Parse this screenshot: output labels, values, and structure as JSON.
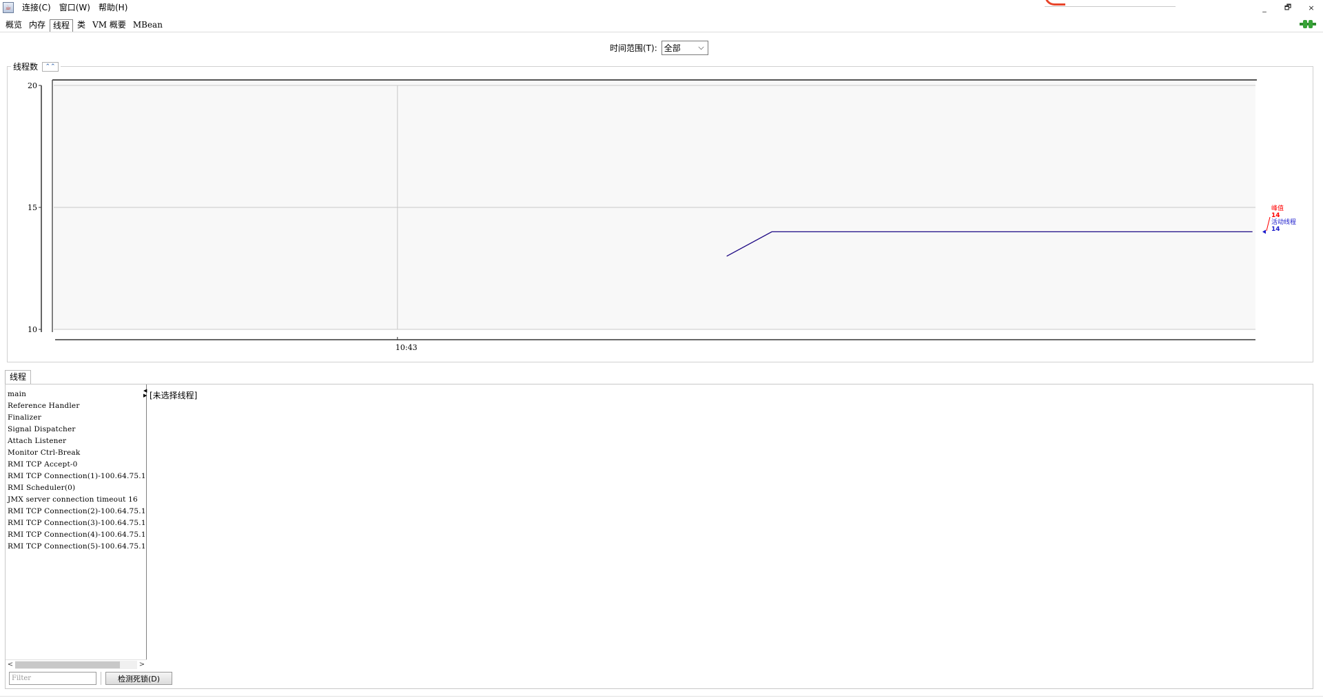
{
  "menu": {
    "items": [
      "连接(C)",
      "窗口(W)",
      "帮助(H)"
    ]
  },
  "window_controls": {
    "minimize": "_",
    "restore": "🗗",
    "close": "×"
  },
  "tabs": [
    {
      "label": "概览",
      "active": false
    },
    {
      "label": "内存",
      "active": false
    },
    {
      "label": "线程",
      "active": true
    },
    {
      "label": "类",
      "active": false
    },
    {
      "label": "VM 概要",
      "active": false
    },
    {
      "label": "MBean",
      "active": false
    }
  ],
  "time_range": {
    "label": "时间范围(T):",
    "selected": "全部"
  },
  "chart_panel": {
    "title": "线程数"
  },
  "chart_data": {
    "type": "line",
    "ylim": [
      10,
      20
    ],
    "yticks": [
      "20",
      "15",
      "10"
    ],
    "xticks": [
      "10:43"
    ],
    "series": [
      {
        "name": "峰值",
        "color": "#ff0000",
        "current_label": "14",
        "points": [
          [
            0.56,
            13
          ],
          [
            0.6,
            14
          ],
          [
            1.0,
            14
          ]
        ]
      },
      {
        "name": "活动线程",
        "color": "#1c1ccc",
        "current_label": "14",
        "points": [
          [
            0.56,
            13
          ],
          [
            0.6,
            14
          ],
          [
            1.0,
            14
          ]
        ]
      }
    ],
    "grid": true
  },
  "threads": {
    "tab_label": "线程",
    "list": [
      "main",
      "Reference Handler",
      "Finalizer",
      "Signal Dispatcher",
      "Attach Listener",
      "Monitor Ctrl-Break",
      "RMI TCP Accept-0",
      "RMI TCP Connection(1)-100.64.75.1",
      "RMI Scheduler(0)",
      "JMX server connection timeout 16",
      "RMI TCP Connection(2)-100.64.75.1",
      "RMI TCP Connection(3)-100.64.75.1",
      "RMI TCP Connection(4)-100.64.75.1",
      "RMI TCP Connection(5)-100.64.75.1"
    ],
    "detail_placeholder": "[未选择线程]",
    "filter_placeholder": "Filter",
    "deadlock_button": "检测死锁(D)"
  },
  "colors": {
    "peak": "#ff0000",
    "live": "#1c1ccc",
    "line": "#1a0f8c"
  }
}
